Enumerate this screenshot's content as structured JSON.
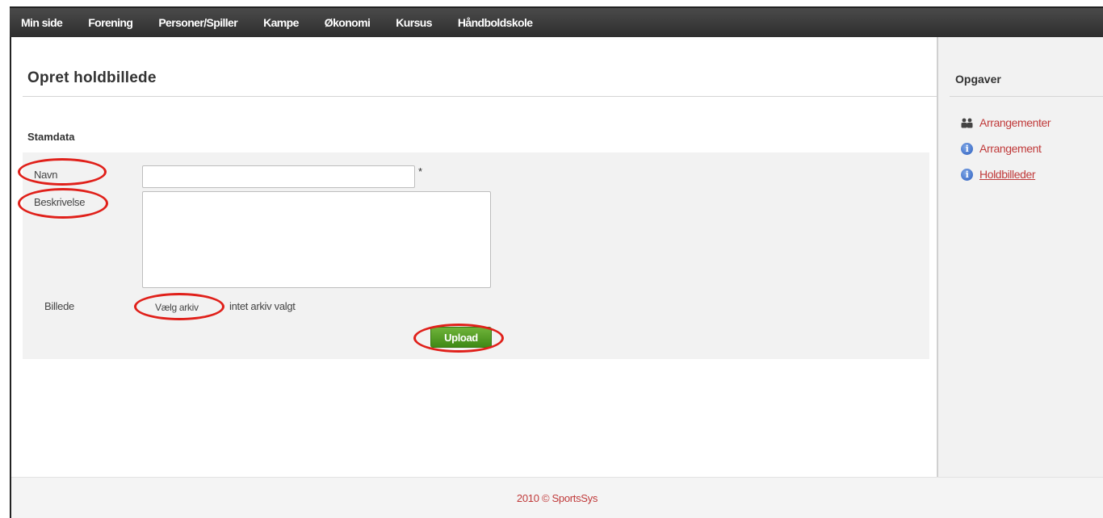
{
  "nav": {
    "items": [
      {
        "label": "Min side"
      },
      {
        "label": "Forening"
      },
      {
        "label": "Personer/Spiller"
      },
      {
        "label": "Kampe"
      },
      {
        "label": "Økonomi"
      },
      {
        "label": "Kursus"
      },
      {
        "label": "Håndboldskole"
      }
    ]
  },
  "page": {
    "title": "Opret holdbillede",
    "section": "Stamdata"
  },
  "form": {
    "name_label": "Navn",
    "name_value": "",
    "required_mark": "*",
    "description_label": "Beskrivelse",
    "description_value": "",
    "image_label": "Billede",
    "file_button": "Vælg arkiv",
    "file_status": "intet arkiv valgt",
    "upload_label": "Upload"
  },
  "sidebar": {
    "title": "Opgaver",
    "tasks": [
      {
        "label": "Arrangementer",
        "icon": "group-icon"
      },
      {
        "label": "Arrangement",
        "icon": "info-icon"
      },
      {
        "label": "Holdbilleder",
        "icon": "info-icon"
      }
    ]
  },
  "footer": {
    "text": "2010 © SportsSys"
  },
  "colors": {
    "accent": "#c03a3a",
    "upload": "#4e9a22",
    "highlight": "#e0201a",
    "topbar": "#333333"
  }
}
